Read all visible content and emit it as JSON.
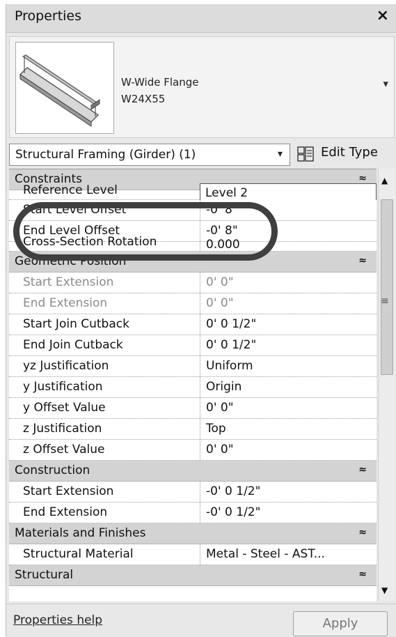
{
  "window": {
    "title": "Properties",
    "close_glyph": "×"
  },
  "type_selector": {
    "family": "W-Wide Flange",
    "type_name": "W24X55",
    "dropdown_glyph": "▾",
    "preview_icon": "steel-beam-icon"
  },
  "filter": {
    "value": "Structural Framing (Girder) (1)",
    "arrow_glyph": "▾"
  },
  "edit_type": {
    "label": "Edit Type",
    "icon": "edit-type-icon"
  },
  "groups": [
    {
      "label": "Constraints",
      "chevron": "≈"
    },
    {
      "label": "Geometric Position",
      "chevron": "≈"
    },
    {
      "label": "Construction",
      "chevron": "≈"
    },
    {
      "label": "Materials and Finishes",
      "chevron": "≈"
    },
    {
      "label": "Structural",
      "chevron": "≈"
    }
  ],
  "constraints": [
    {
      "label": "Reference Level",
      "value": "Level 2"
    },
    {
      "label": "Start Level Offset",
      "value": "-0'  8\""
    },
    {
      "label": "End Level Offset",
      "value": "-0'  8\""
    },
    {
      "label": "Cross-Section Rotation",
      "value": "0.000"
    }
  ],
  "geometric_position": [
    {
      "label": "Start Extension",
      "value": "0'  0\""
    },
    {
      "label": "End Extension",
      "value": "0'  0\""
    },
    {
      "label": "Start Join Cutback",
      "value": "0'  0 1/2\""
    },
    {
      "label": "End Join Cutback",
      "value": "0'  0 1/2\""
    },
    {
      "label": "yz Justification",
      "value": "Uniform"
    },
    {
      "label": "y Justification",
      "value": "Origin"
    },
    {
      "label": "y Offset Value",
      "value": "0'  0\""
    },
    {
      "label": "z Justification",
      "value": "Top"
    },
    {
      "label": "z Offset Value",
      "value": "0'  0\""
    }
  ],
  "construction": [
    {
      "label": "Start Extension",
      "value": "-0'  0 1/2\""
    },
    {
      "label": "End Extension",
      "value": "-0'  0 1/2\""
    }
  ],
  "materials": [
    {
      "label": "Structural Material",
      "value": "Metal - Steel - AST..."
    }
  ],
  "scrollbar": {
    "up_glyph": "▲",
    "down_glyph": "▼",
    "grip_glyph": "≡"
  },
  "footer": {
    "help_label": "Properties help",
    "apply_label": "Apply"
  }
}
